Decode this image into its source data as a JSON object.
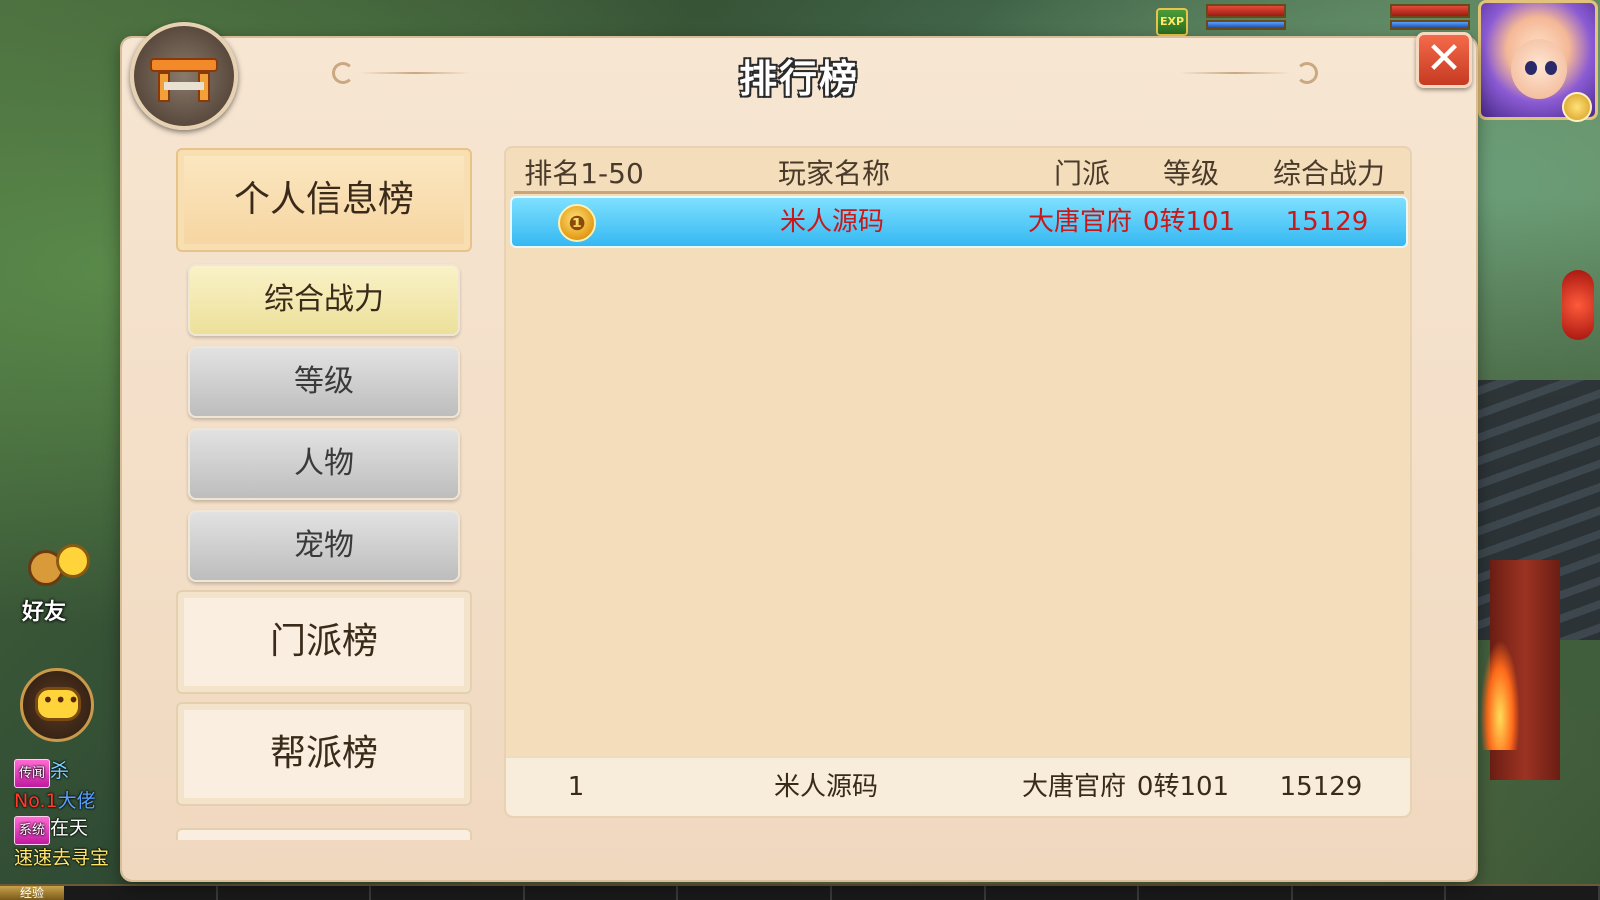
{
  "panel": {
    "title": "排行榜",
    "close_icon": "✕"
  },
  "categories": {
    "personal": "个人信息榜",
    "sub": [
      "综合战力",
      "等级",
      "人物",
      "宠物"
    ],
    "sect": "门派榜",
    "guild": "帮派榜"
  },
  "table": {
    "headers": {
      "rank": "排名1-50",
      "name": "玩家名称",
      "school": "门派",
      "level": "等级",
      "power": "综合战力"
    },
    "rows": [
      {
        "rank": 1,
        "rank_icon": "first-place-medal-icon",
        "name": "米人源码",
        "school": "大唐官府",
        "level": "0转101",
        "power": "15129"
      }
    ],
    "self_row": {
      "rank": "1",
      "name": "米人源码",
      "school": "大唐官府",
      "level": "0转101",
      "power": "15129"
    }
  },
  "hud": {
    "exp_badge": "EXP",
    "friends_label": "好友",
    "exp_bar_label": "经验"
  },
  "chat_log": {
    "line1_tag": "传闻",
    "line1_text": "杀",
    "line2_red": "No.1",
    "line2_text": "大佬",
    "line3_tag": "系统",
    "line3_text": "在天",
    "line4_text": "速速去寻宝"
  },
  "colors": {
    "panel_bg": "#f7e6d2",
    "highlight_row": "#36b8f2",
    "highlight_text": "#c8181a",
    "close_button": "#c63a22",
    "active_tab": "#f6d5a0"
  }
}
